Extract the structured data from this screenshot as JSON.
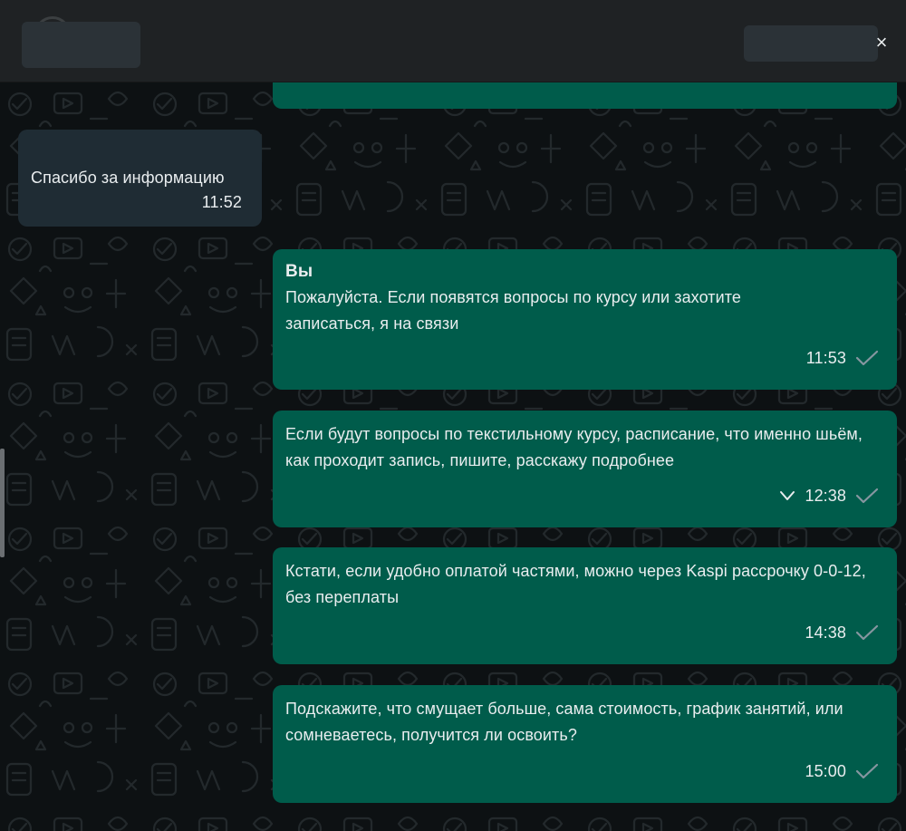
{
  "header": {
    "close_label": "×"
  },
  "messages": [
    {
      "direction": "in",
      "text": "Спасибо за информацию",
      "time": "11:52"
    },
    {
      "direction": "out",
      "sender": "Вы",
      "text": "Пожалуйста. Если появятся вопросы по курсу или захотите записаться, я на связи",
      "time": "11:53",
      "status": "check-icon"
    },
    {
      "direction": "out",
      "text": "Если будут вопросы по текстильному курсу, расписание, что именно шьём, как проходит запись, пишите, расскажу подробнее",
      "time": "12:38",
      "status": "check-icon",
      "menu_icon": "chevron-down-icon"
    },
    {
      "direction": "out",
      "text": "Кстати, если удобно оплатой частями, можно через Kaspi рассрочку 0-0-12, без переплаты",
      "time": "14:38",
      "status": "check-icon"
    },
    {
      "direction": "out",
      "text": "Подскажите, что смущает больше, сама стоимость, график занятий, или сомневаетесь, получится ли освоить?",
      "time": "15:00",
      "status": "check-icon"
    }
  ],
  "colors": {
    "outgoing_bubble": "#005c4b",
    "incoming_bubble": "#1f2c34",
    "chat_background": "#0d1113",
    "header_background": "#1f2224",
    "text": "#e9edef",
    "status_tick": "#8696a0"
  }
}
